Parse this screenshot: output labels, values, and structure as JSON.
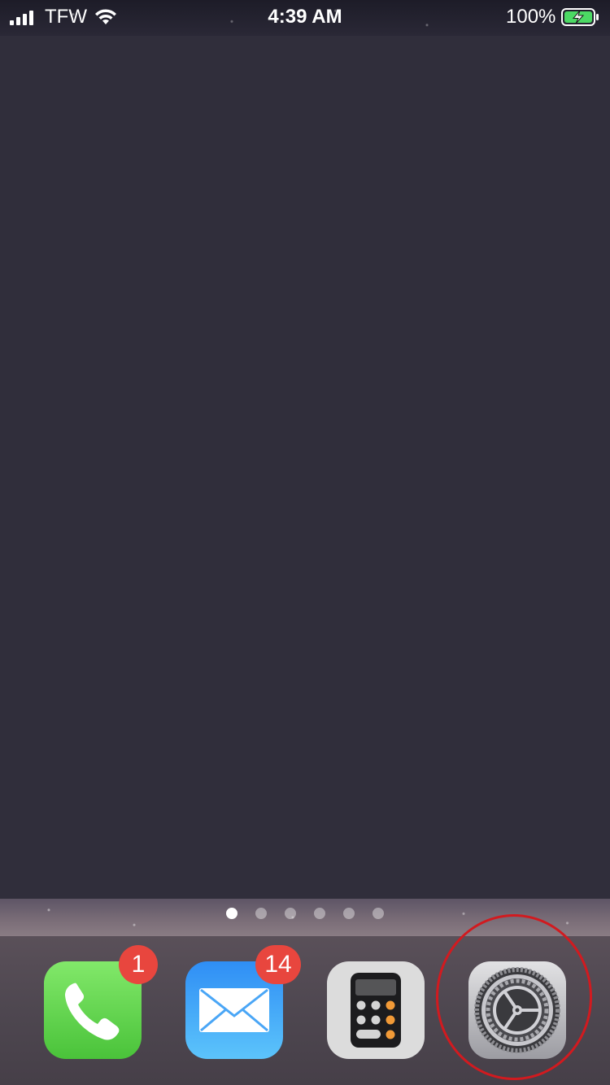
{
  "status_bar": {
    "carrier": "TFW",
    "time": "4:39 AM",
    "battery_percent": "100%",
    "signal_bars": 4,
    "charging": true,
    "icons": [
      "signal-icon",
      "wifi-icon",
      "battery-charging-icon"
    ]
  },
  "page_indicator": {
    "count": 6,
    "active_index": 0
  },
  "dock": {
    "apps": [
      {
        "name": "Phone",
        "icon": "phone-icon",
        "color": "#4ac33a",
        "badge": "1"
      },
      {
        "name": "Mail",
        "icon": "mail-icon",
        "color": "#2f8ef5",
        "badge": "14"
      },
      {
        "name": "Calculator",
        "icon": "calculator-icon",
        "color": "#dcdcdc",
        "badge": ""
      },
      {
        "name": "Settings",
        "icon": "gear-icon",
        "color": "#9c9ca2",
        "badge": ""
      }
    ],
    "highlighted_app": "Settings",
    "highlight_color": "#d21a1f"
  }
}
